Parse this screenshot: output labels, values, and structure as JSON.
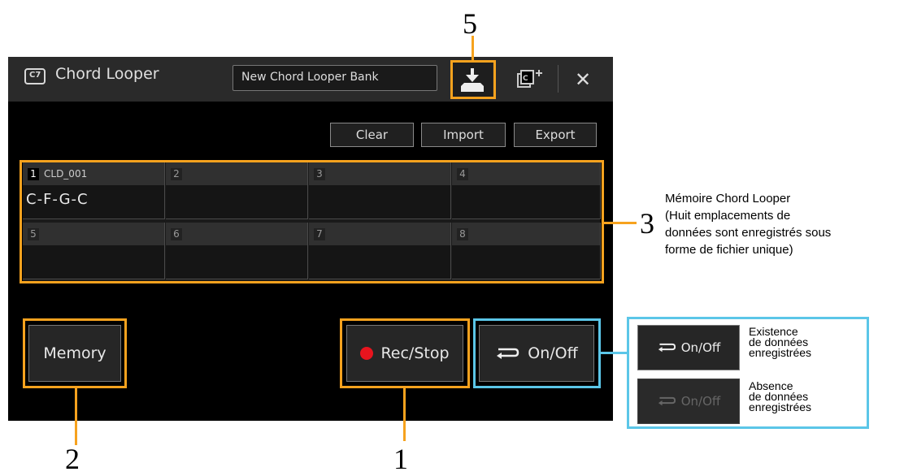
{
  "window": {
    "app_icon_glyph": "C7",
    "title": "Chord Looper",
    "bank_name": "New Chord Looper Bank",
    "close_glyph": "✕"
  },
  "toolbar": {
    "clear_label": "Clear",
    "import_label": "Import",
    "export_label": "Export"
  },
  "slots": [
    {
      "number": "1",
      "name": "CLD_001",
      "chords": "C-F-G-C"
    },
    {
      "number": "2",
      "name": "",
      "chords": ""
    },
    {
      "number": "3",
      "name": "",
      "chords": ""
    },
    {
      "number": "4",
      "name": "",
      "chords": ""
    },
    {
      "number": "5",
      "name": "",
      "chords": ""
    },
    {
      "number": "6",
      "name": "",
      "chords": ""
    },
    {
      "number": "7",
      "name": "",
      "chords": ""
    },
    {
      "number": "8",
      "name": "",
      "chords": ""
    }
  ],
  "buttons": {
    "memory_label": "Memory",
    "recstop_label": "Rec/Stop",
    "onoff_label": "On/Off"
  },
  "callouts": {
    "n1": "1",
    "n2": "2",
    "n3": "3",
    "n5": "5",
    "n3_text": [
      "Mémoire Chord Looper",
      "(Huit emplacements de",
      "données sont enregistrés sous",
      "forme de fichier unique)"
    ]
  },
  "legend": {
    "active_label": "On/Off",
    "active_text": [
      "Existence",
      "de données",
      "enregistrées"
    ],
    "inactive_label": "On/Off",
    "inactive_text": [
      "Absence",
      "de données",
      "enregistrées"
    ]
  },
  "colors": {
    "highlight_orange": "#f6a21e",
    "highlight_blue": "#5bc6e8",
    "rec_red": "#e8141e"
  }
}
